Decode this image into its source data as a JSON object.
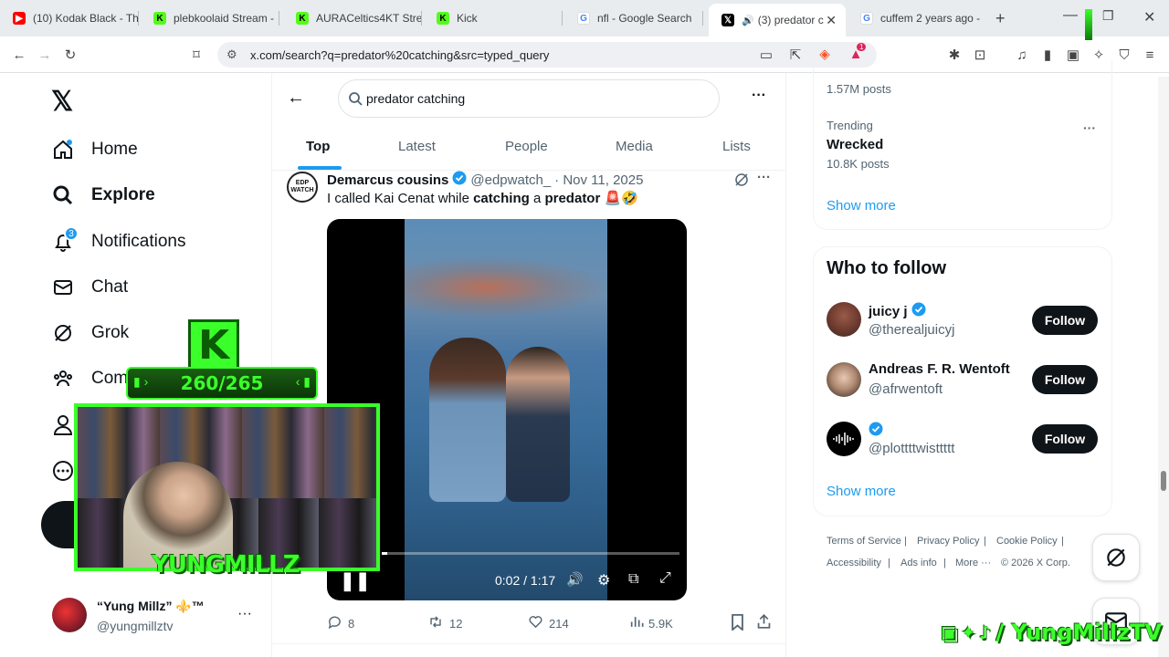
{
  "browser": {
    "tabs": [
      {
        "title": "(10) Kodak Black - Th",
        "icon": "youtube-icon",
        "color": "#ff0000"
      },
      {
        "title": "plebkoolaid Stream -",
        "icon": "kick-icon",
        "color": "#53fc18"
      },
      {
        "title": "AURACeltics4KT Strea",
        "icon": "kick-icon",
        "color": "#53fc18"
      },
      {
        "title": "Kick",
        "icon": "kick-icon",
        "color": "#53fc18"
      },
      {
        "title": "nfl - Google Search",
        "icon": "google-icon",
        "color": "#4285f4"
      },
      {
        "title": "(3) predator c",
        "icon": "x-icon",
        "color": "#000000"
      },
      {
        "title": "cuffem 2 years ago -",
        "icon": "google-icon",
        "color": "#4285f4"
      }
    ],
    "url": "x.com/search?q=predator%20catching&src=typed_query",
    "brave_badge": "1"
  },
  "nav": {
    "items": [
      {
        "label": "Home",
        "icon": "home-icon"
      },
      {
        "label": "Explore",
        "icon": "search-icon"
      },
      {
        "label": "Notifications",
        "icon": "bell-icon",
        "badge": "3"
      },
      {
        "label": "Chat",
        "icon": "mail-icon"
      },
      {
        "label": "Grok",
        "icon": "grok-icon"
      },
      {
        "label": "Com",
        "icon": "communities-icon"
      }
    ],
    "profile": {
      "name": "“Yung Millz” ⚜️™",
      "handle": "@yungmillztv"
    }
  },
  "search": {
    "query": "predator catching",
    "tabs": [
      "Top",
      "Latest",
      "People",
      "Media",
      "Lists"
    ],
    "active_tab": "Top"
  },
  "tweet": {
    "name": "Demarcus cousins",
    "handle": "@edpwatch_",
    "date": "· Nov 11, 2025",
    "text_pre": "I called Kai Cenat while ",
    "text_b1": "catching",
    "text_mid": " a ",
    "text_b2": "predator",
    "text_post": " 🚨🤣",
    "avatar_text": "EDP WATCH",
    "video_time": "0:02 / 1:17",
    "video_progress": 0.017,
    "stats": {
      "replies": "8",
      "reposts": "12",
      "likes": "214",
      "views": "5.9K"
    }
  },
  "trends": {
    "partial_count": "1.57M posts",
    "label": "Trending",
    "name": "Wrecked",
    "count": "10.8K posts",
    "show_more": "Show more"
  },
  "who_to_follow": {
    "title": "Who to follow",
    "users": [
      {
        "name": "juicy j",
        "handle": "@therealjuicyj",
        "verified": true,
        "button": "Follow"
      },
      {
        "name": "Andreas F. R. Wentoft",
        "handle": "@afrwentoft",
        "verified": false,
        "button": "Follow"
      },
      {
        "name": "",
        "handle": "@plottttwisttttt",
        "verified": true,
        "button": "Follow"
      }
    ],
    "show_more": "Show more"
  },
  "footer": {
    "links": [
      "Terms of Service",
      "Privacy Policy",
      "Cookie Policy",
      "Accessibility",
      "Ads info",
      "More ···"
    ],
    "copyright": "© 2026 X Corp."
  },
  "overlay": {
    "kick_count": "260/265",
    "streamer_name": "YUNGMILLZ",
    "socials": "/ YungMillzTV"
  },
  "colors": {
    "accent": "#1d9bf0",
    "overlay_green": "#3bff2a",
    "text": "#0f1419",
    "muted": "#536471"
  }
}
